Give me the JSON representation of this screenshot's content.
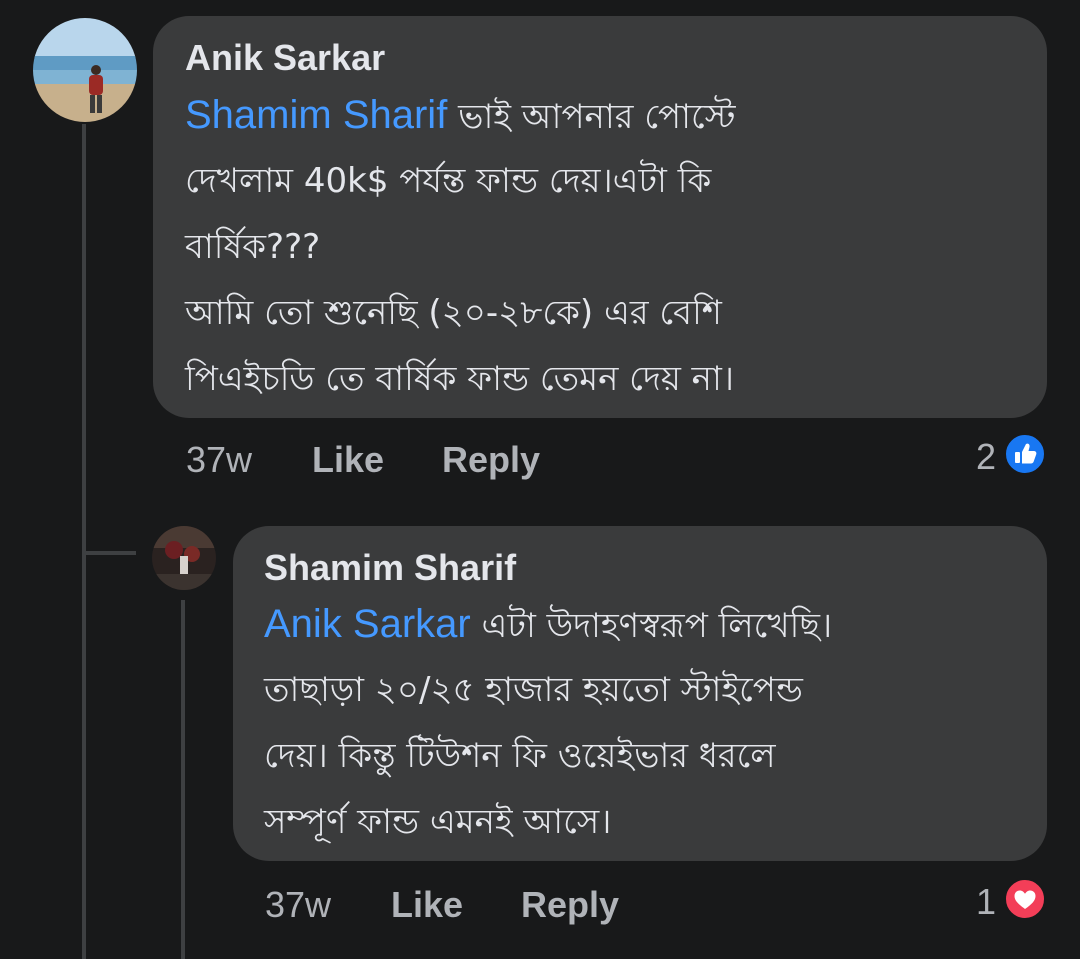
{
  "comments": [
    {
      "author": "Anik Sarkar",
      "mention": "Shamim Sharif",
      "lines": [
        " ভাই আপনার পোস্টে",
        "দেখলাম  40k$ পর্যন্ত ফান্ড দেয়।এটা কি",
        "বার্ষিক???",
        "আমি তো শুনেছি (২০-২৮কে) এর বেশি",
        "পিএইচডি তে বার্ষিক  ফান্ড তেমন দেয় না।"
      ],
      "time": "37w",
      "like_label": "Like",
      "reply_label": "Reply",
      "reaction_count": "2",
      "reaction_type": "like-icon",
      "reaction_color": "#1877f2"
    },
    {
      "author": "Shamim Sharif",
      "mention": "Anik Sarkar",
      "lines": [
        " এটা উদাহণস্বরূপ লিখেছি।",
        "তাছাড়া ২০/২৫ হাজার হয়তো স্টাইপেন্ড",
        "দেয়। কিন্তু টিউশন ফি ওয়েইভার ধরলে",
        "সম্পূর্ণ ফান্ড এমনই আসে।"
      ],
      "time": "37w",
      "like_label": "Like",
      "reply_label": "Reply",
      "reaction_count": "1",
      "reaction_type": "love-icon",
      "reaction_color": "#f33e58"
    }
  ]
}
